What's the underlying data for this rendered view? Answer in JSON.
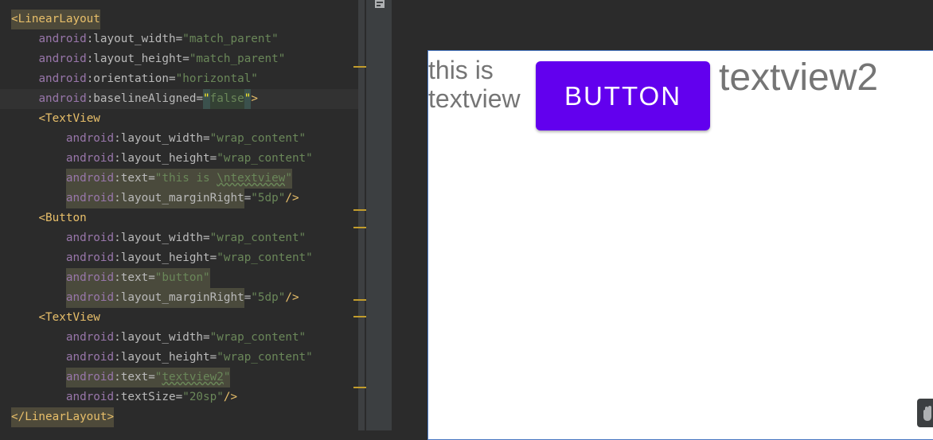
{
  "editor": {
    "lines": [
      {
        "parts": [
          [
            "c-tagbr hl-tag",
            "<"
          ],
          [
            "c-tag hl-tag",
            "LinearLayout"
          ]
        ]
      },
      {
        "parts": [
          [
            "c-attr",
            "    "
          ],
          [
            "c-attrns",
            "android"
          ],
          [
            "c-attr",
            ":layout_width"
          ],
          [
            "c-eq",
            "="
          ],
          [
            "c-str",
            "\"match_parent\""
          ]
        ]
      },
      {
        "parts": [
          [
            "c-attr",
            "    "
          ],
          [
            "c-attrns",
            "android"
          ],
          [
            "c-attr",
            ":layout_height"
          ],
          [
            "c-eq",
            "="
          ],
          [
            "c-str",
            "\"match_parent\""
          ]
        ]
      },
      {
        "parts": [
          [
            "c-attr",
            "    "
          ],
          [
            "c-attrns",
            "android"
          ],
          [
            "c-attr",
            ":orientation"
          ],
          [
            "c-eq",
            "="
          ],
          [
            "c-str",
            "\"horizontal\""
          ]
        ]
      },
      {
        "parts": [
          [
            "c-attr",
            "    "
          ],
          [
            "c-attrns",
            "android"
          ],
          [
            "c-attr",
            ":baselineAligned"
          ],
          [
            "c-eq",
            "="
          ],
          [
            "hl-quote",
            "\""
          ],
          [
            "c-str caret-mark",
            "false"
          ],
          [
            "hl-quote",
            "\""
          ],
          [
            "c-punc",
            ">"
          ]
        ],
        "current": true
      },
      {
        "parts": [
          [
            "c-attr",
            "    "
          ],
          [
            "c-tagbr",
            "<"
          ],
          [
            "c-tag",
            "TextView"
          ]
        ]
      },
      {
        "parts": [
          [
            "c-attr",
            "        "
          ],
          [
            "c-attrns",
            "android"
          ],
          [
            "c-attr",
            ":layout_width"
          ],
          [
            "c-eq",
            "="
          ],
          [
            "c-str",
            "\"wrap_content\""
          ]
        ]
      },
      {
        "parts": [
          [
            "c-attr",
            "        "
          ],
          [
            "c-attrns",
            "android"
          ],
          [
            "c-attr",
            ":layout_height"
          ],
          [
            "c-eq",
            "="
          ],
          [
            "c-str",
            "\"wrap_content\""
          ]
        ]
      },
      {
        "parts": [
          [
            "c-attr",
            "        "
          ],
          [
            "c-attrns hl-line",
            "android"
          ],
          [
            "c-attr hl-line",
            ":text"
          ],
          [
            "c-eq hl-line",
            "="
          ],
          [
            "c-str hl-line",
            "\"this is "
          ],
          [
            "c-str hl-line wavy",
            "\\ntextview"
          ],
          [
            "c-str hl-line",
            "\""
          ]
        ]
      },
      {
        "parts": [
          [
            "c-attr",
            "        "
          ],
          [
            "c-attrns hl-line",
            "android"
          ],
          [
            "c-attr hl-line",
            ":layout_marginRight"
          ],
          [
            "c-eq",
            "="
          ],
          [
            "c-str",
            "\"5dp\""
          ],
          [
            "c-punc",
            "/>"
          ]
        ]
      },
      {
        "parts": [
          [
            "c-attr",
            "    "
          ],
          [
            "c-tagbr",
            "<"
          ],
          [
            "c-tag",
            "Button"
          ]
        ]
      },
      {
        "parts": [
          [
            "c-attr",
            "        "
          ],
          [
            "c-attrns",
            "android"
          ],
          [
            "c-attr",
            ":layout_width"
          ],
          [
            "c-eq",
            "="
          ],
          [
            "c-str",
            "\"wrap_content\""
          ]
        ]
      },
      {
        "parts": [
          [
            "c-attr",
            "        "
          ],
          [
            "c-attrns",
            "android"
          ],
          [
            "c-attr",
            ":layout_height"
          ],
          [
            "c-eq",
            "="
          ],
          [
            "c-str",
            "\"wrap_content\""
          ]
        ]
      },
      {
        "parts": [
          [
            "c-attr",
            "        "
          ],
          [
            "c-attrns hl-line",
            "android"
          ],
          [
            "c-attr hl-line",
            ":text"
          ],
          [
            "c-eq hl-line",
            "="
          ],
          [
            "c-str hl-line",
            "\"button\""
          ]
        ]
      },
      {
        "parts": [
          [
            "c-attr",
            "        "
          ],
          [
            "c-attrns hl-line",
            "android"
          ],
          [
            "c-attr hl-line",
            ":layout_marginRight"
          ],
          [
            "c-eq",
            "="
          ],
          [
            "c-str",
            "\"5dp\""
          ],
          [
            "c-punc",
            "/>"
          ]
        ]
      },
      {
        "parts": [
          [
            "c-attr",
            "    "
          ],
          [
            "c-tagbr",
            "<"
          ],
          [
            "c-tag",
            "TextView"
          ]
        ]
      },
      {
        "parts": [
          [
            "c-attr",
            "        "
          ],
          [
            "c-attrns",
            "android"
          ],
          [
            "c-attr",
            ":layout_width"
          ],
          [
            "c-eq",
            "="
          ],
          [
            "c-str",
            "\"wrap_content\""
          ]
        ]
      },
      {
        "parts": [
          [
            "c-attr",
            "        "
          ],
          [
            "c-attrns",
            "android"
          ],
          [
            "c-attr",
            ":layout_height"
          ],
          [
            "c-eq",
            "="
          ],
          [
            "c-str",
            "\"wrap_content\""
          ]
        ]
      },
      {
        "parts": [
          [
            "c-attr",
            "        "
          ],
          [
            "c-attrns hl-line",
            "android"
          ],
          [
            "c-attr hl-line",
            ":text"
          ],
          [
            "c-eq hl-line",
            "="
          ],
          [
            "c-str hl-line",
            "\""
          ],
          [
            "c-str hl-line wavy",
            "textview2"
          ],
          [
            "c-str hl-line",
            "\""
          ]
        ]
      },
      {
        "parts": [
          [
            "c-attr",
            "        "
          ],
          [
            "c-attrns",
            "android"
          ],
          [
            "c-attr",
            ":textSize"
          ],
          [
            "c-eq",
            "="
          ],
          [
            "c-str",
            "\"20sp\""
          ],
          [
            "c-punc",
            "/>"
          ]
        ]
      },
      {
        "parts": [
          [
            "c-tagbr hl-tag",
            "</"
          ],
          [
            "c-tag hl-tag",
            "LinearLayout"
          ],
          [
            "c-tagbr hl-tag",
            ">"
          ]
        ]
      }
    ]
  },
  "preview": {
    "textview1": "this is\ntextview",
    "button_label": "BUTTON",
    "textview2": "textview2"
  },
  "icons": {
    "toolstrip": "palette-icon",
    "pan": "hand-icon"
  },
  "colors": {
    "button": "#6200ee",
    "text": "#757575"
  }
}
